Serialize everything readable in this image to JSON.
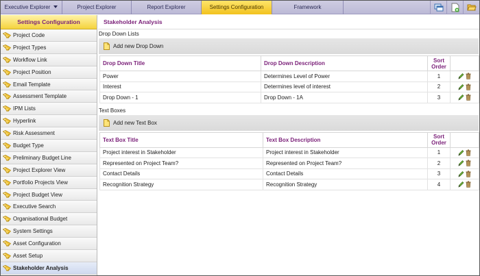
{
  "topnav": {
    "tabs": [
      {
        "label": "Executive Explorer",
        "has_dropdown": true,
        "active": false
      },
      {
        "label": "Project Explorer",
        "has_dropdown": false,
        "active": false
      },
      {
        "label": "Report Explorer",
        "has_dropdown": false,
        "active": false
      },
      {
        "label": "Settings Configuration",
        "has_dropdown": false,
        "active": true
      },
      {
        "label": "Framework",
        "has_dropdown": false,
        "active": false
      }
    ],
    "icons": [
      "window-icon",
      "new-document-icon",
      "open-folder-icon"
    ]
  },
  "sidebar": {
    "title": "Settings Configuration",
    "items": [
      "Project Code",
      "Project Types",
      "Workflow Link",
      "Project Position",
      "Email Template",
      "Assessment Template",
      "IPM Lists",
      "Hyperlink",
      "Risk Assessment",
      "Budget Type",
      "Preliminary Budget Line",
      "Project Explorer View",
      "Portfolio Projects View",
      "Project Budget View",
      "Executive Search",
      "Organisational Budget",
      "System Settings",
      "Asset Configuration",
      "Asset Setup",
      "Stakeholder Analysis"
    ],
    "active_item": "Stakeholder Analysis"
  },
  "main": {
    "title": "Stakeholder Analysis",
    "dropdown_section": {
      "title": "Drop Down Lists",
      "add_label": "Add new Drop Down",
      "columns": [
        "Drop Down Title",
        "Drop Down Description",
        "Sort Order"
      ],
      "rows": [
        {
          "title": "Power",
          "description": "Determines Level of Power",
          "sort": "1"
        },
        {
          "title": "Interest",
          "description": "Determines level of interest",
          "sort": "2"
        },
        {
          "title": "Drop Down - 1",
          "description": "Drop Down - 1A",
          "sort": "3"
        }
      ]
    },
    "textbox_section": {
      "title": "Text Boxes",
      "add_label": "Add new Text Box",
      "columns": [
        "Text Box Title",
        "Text Box Description",
        "Sort Order"
      ],
      "rows": [
        {
          "title": "Project interest in Stakeholder",
          "description": "Project interest in Stakeholder",
          "sort": "1"
        },
        {
          "title": "Represented on Project Team?",
          "description": "Represented on Project Team?",
          "sort": "2"
        },
        {
          "title": "Contact Details",
          "description": "Contact Details",
          "sort": "3"
        },
        {
          "title": "Recognition Strategy",
          "description": "Recognition Strategy",
          "sort": "4"
        }
      ]
    }
  },
  "colors": {
    "accent_purple": "#7a1f78",
    "active_tab_yellow": "#f2c21e",
    "nav_lavender": "#c4c1db"
  }
}
